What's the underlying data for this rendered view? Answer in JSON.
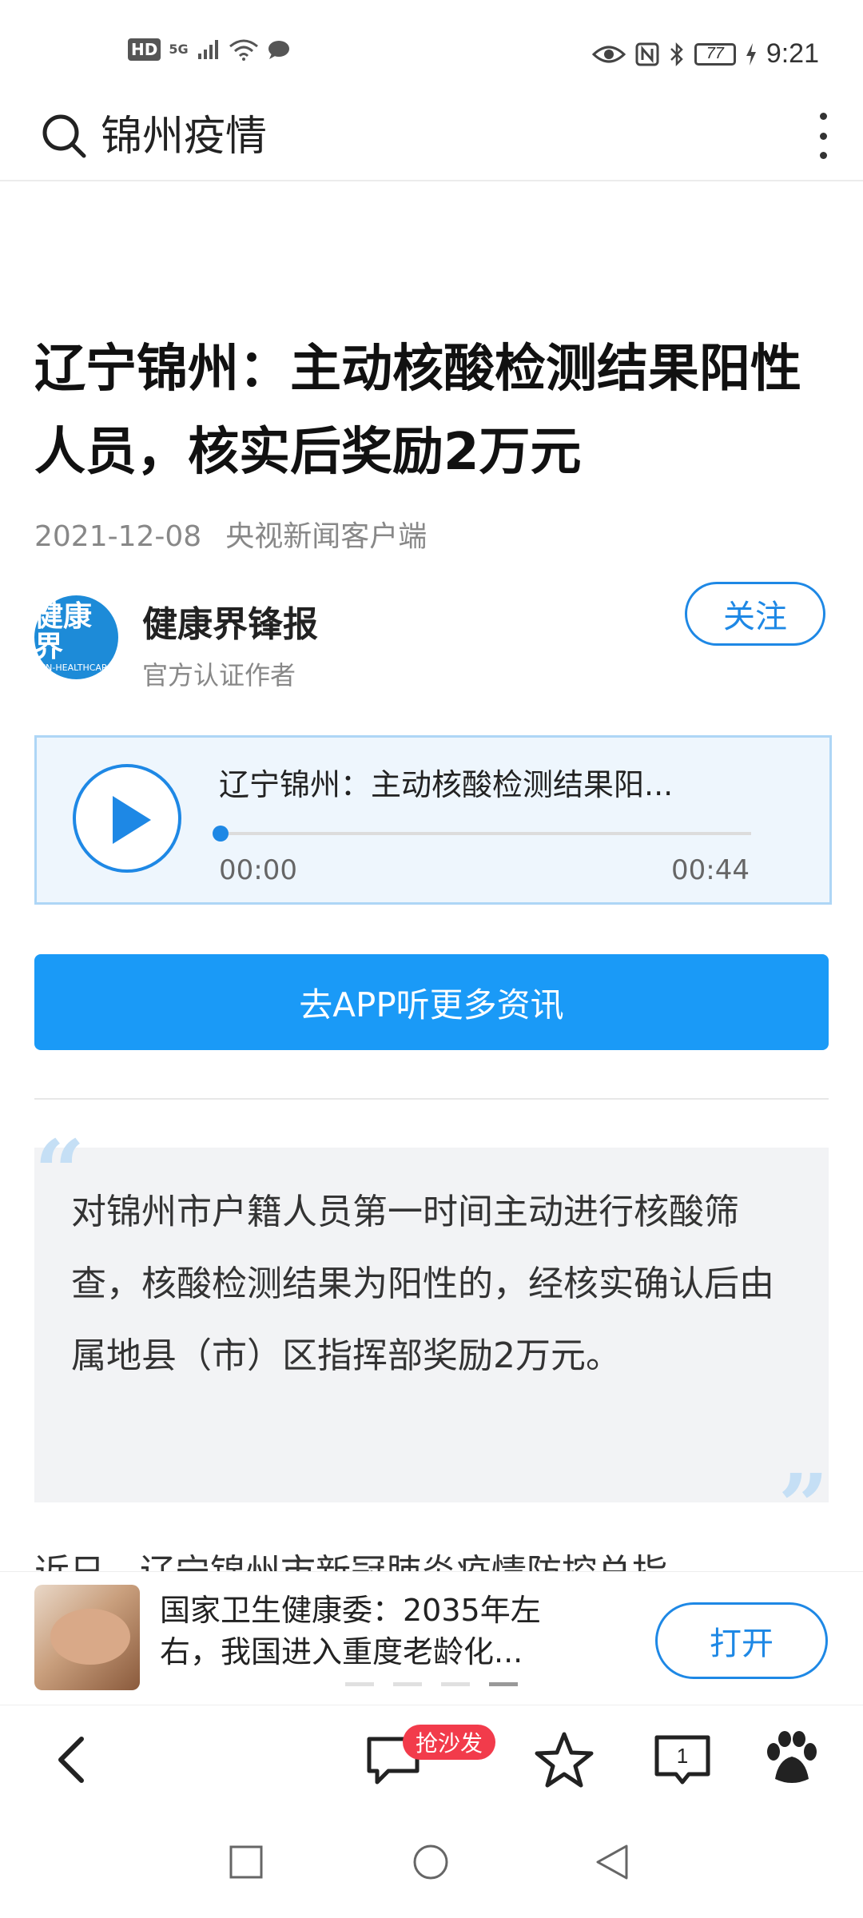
{
  "status_bar": {
    "left_indicators": [
      "HD",
      "5G"
    ],
    "battery": "77",
    "time": "9:21"
  },
  "search": {
    "query": "锦州疫情"
  },
  "article": {
    "title": "辽宁锦州：主动核酸检测结果阳性人员，核实后奖励2万元",
    "date": "2021-12-08",
    "source": "央视新闻客户端",
    "author": {
      "name": "健康界锋报",
      "subtitle": "官方认证作者",
      "avatar_text": "健康界",
      "avatar_subtext": "CN-HEALTHCARE",
      "follow_label": "关注"
    },
    "audio": {
      "title": "辽宁锦州：主动核酸检测结果阳...",
      "current_time": "00:00",
      "duration": "00:44",
      "progress": 0
    },
    "app_button_label": "去APP听更多资讯",
    "quote": "对锦州市户籍人员第一时间主动进行核酸筛查，核酸检测结果为阳性的，经核实确认后由属地县（市）区指挥部奖励2万元。",
    "next_paragraph_partial": "近日，辽宁锦州市新冠肺炎疫情防控总指"
  },
  "recommendation": {
    "title": "国家卫生健康委：2035年左右，我国进入重度老龄化...",
    "open_label": "打开",
    "dots": 4,
    "active_dot": 3
  },
  "toolbar": {
    "comment_badge": "抢沙发",
    "feed_count": "1"
  },
  "colors": {
    "accent": "#1e88e5",
    "button_blue": "#1a9af7",
    "badge_red": "#f23b4b",
    "player_bg": "#eef6fd"
  }
}
